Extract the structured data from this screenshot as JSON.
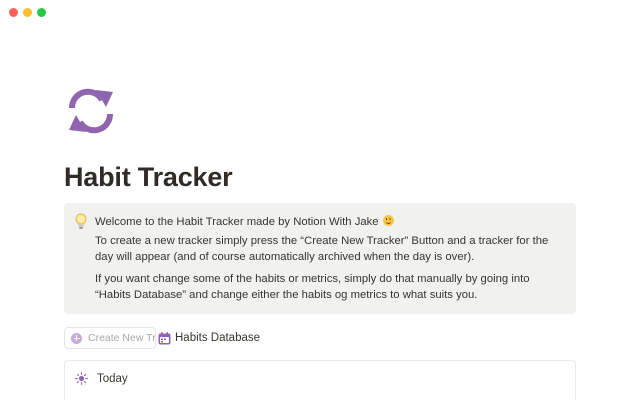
{
  "window": {
    "traffic_lights": [
      "close",
      "minimize",
      "zoom"
    ],
    "colors": {
      "close": "#fe5f57",
      "minimize": "#febc2e",
      "zoom": "#28c840"
    }
  },
  "page": {
    "icon": "sync-arrows-icon",
    "icon_color": "#9065b0",
    "title": "Habit Tracker"
  },
  "callout": {
    "icon": "lightbulb-icon",
    "background": "#f1f1ef",
    "paragraphs": [
      "Welcome to the Habit Tracker made by Notion With Jake",
      "To create a new tracker simply press the “Create New Tracker” Button and a tracker for the day will appear (and of course automatically archived when the day is over).",
      "If you want change some of the habits or metrics, simply do that manually by going into “Habits Database” and change either the habits og metrics to what suits you."
    ],
    "emoji": "smiling-face-icon"
  },
  "actions": {
    "create_button_label": "Create New Tr...",
    "create_button_icon": "plus-circle-icon",
    "database_link_label": "Habits Database",
    "database_link_icon": "calendar-icon"
  },
  "database": {
    "view_icon": "sun-icon",
    "view_label": "Today"
  },
  "accent": "#9065b0"
}
